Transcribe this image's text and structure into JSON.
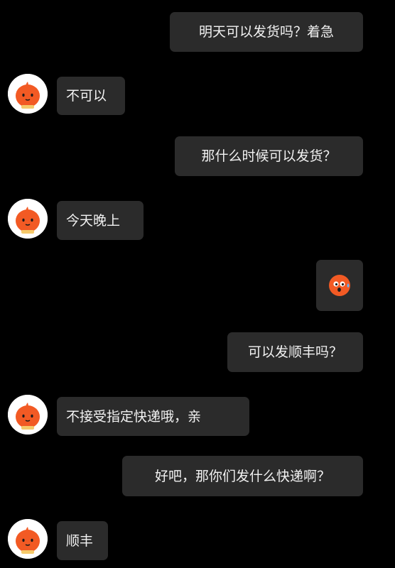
{
  "messages": [
    {
      "side": "sent",
      "text": "明天可以发货吗？着急"
    },
    {
      "side": "received",
      "text": "不可以"
    },
    {
      "side": "sent",
      "text": "那什么时候可以发货？"
    },
    {
      "side": "received",
      "text": "今天晚上"
    },
    {
      "side": "sent",
      "type": "sticker",
      "icon": "nervous-sweat-face-emoji"
    },
    {
      "side": "sent",
      "text": "可以发顺丰吗？"
    },
    {
      "side": "received",
      "text": "不接受指定快递哦，亲"
    },
    {
      "side": "sent",
      "text": "好吧，那你们发什么快递啊？"
    },
    {
      "side": "received",
      "text": "顺丰"
    }
  ],
  "colors": {
    "background": "#000000",
    "bubble": "#2b2b2b",
    "text": "#f2f2f2",
    "avatar_accent": "#f25a24"
  }
}
